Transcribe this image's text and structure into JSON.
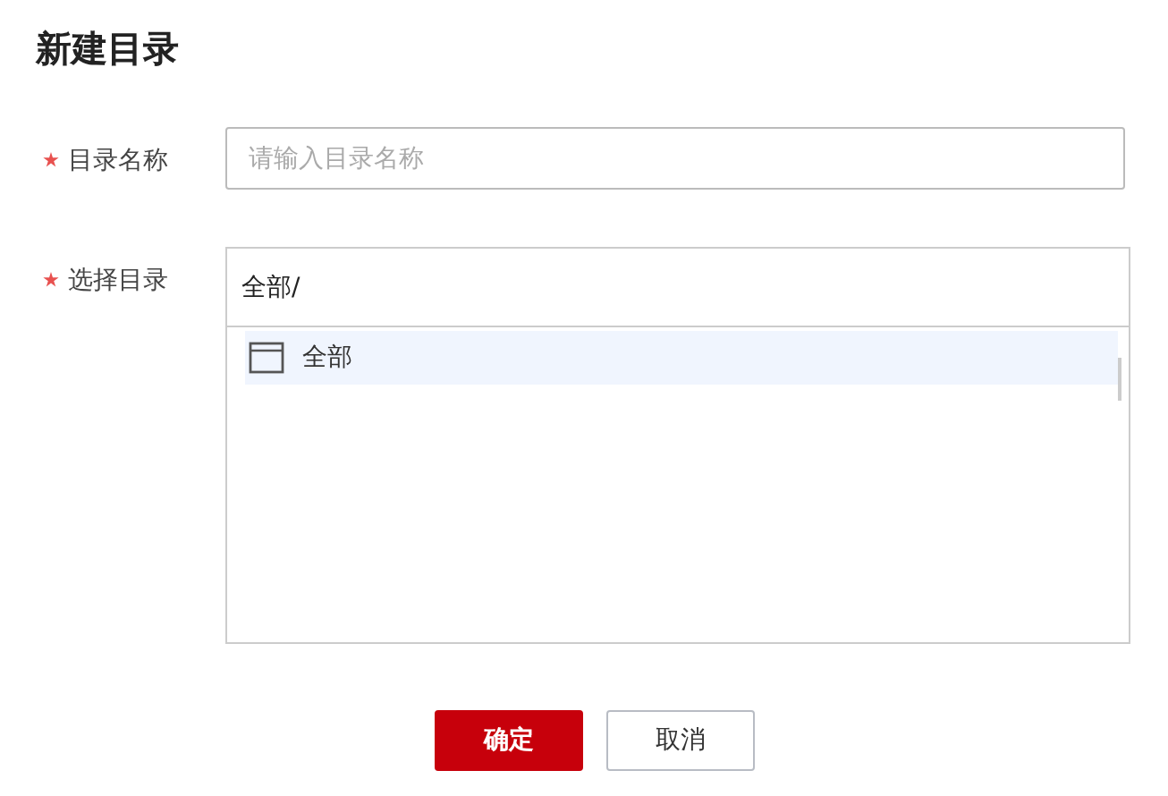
{
  "title": "新建目录",
  "name_field": {
    "label": "目录名称",
    "required": true,
    "placeholder": "请输入目录名称"
  },
  "directory_field": {
    "label": "选择目录",
    "required": true,
    "path": "全部/",
    "tree": [
      {
        "label": "全部",
        "selected": true
      }
    ]
  },
  "buttons": [
    {
      "label": "确定",
      "kind": "primary"
    },
    {
      "label": "取消",
      "kind": "secondary"
    }
  ]
}
